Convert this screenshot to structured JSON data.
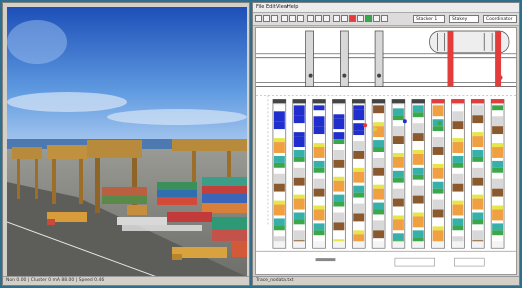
{
  "left_window": {
    "title": "",
    "status_text": "Non 0.00 | Cluster 0 mA 88.00 | Speed 0.46"
  },
  "right_window": {
    "menu": [
      "File",
      "Edit",
      "View",
      "Help"
    ],
    "toolbar": {
      "field1": "Stacker 1",
      "field2": "Stakey",
      "field3": "Coordinator"
    },
    "status_text": "Trace_nodata.txt"
  },
  "colors": {
    "sky": "#3a6fc4",
    "ground": "#8c8c88",
    "crane": "#b88a3c",
    "bay_red": "#e23c3c",
    "selected_blue": "#1f2ecc"
  },
  "icons": [
    "new-file-icon",
    "open-icon",
    "save-icon",
    "cut-icon",
    "copy-icon",
    "paste-icon",
    "undo-icon",
    "redo-icon",
    "print-icon",
    "zoom-icon",
    "play-icon",
    "stop-icon",
    "step-icon",
    "settings-icon",
    "red-flag-icon",
    "green-flag-icon"
  ]
}
